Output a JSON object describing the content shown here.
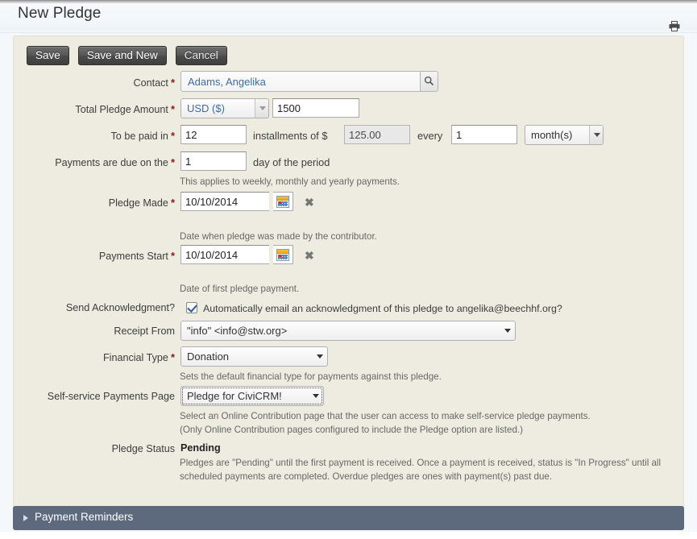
{
  "header": {
    "title": "New Pledge",
    "print_icon": "print-icon"
  },
  "toolbar": {
    "save_label": "Save",
    "save_and_new_label": "Save and New",
    "cancel_label": "Cancel"
  },
  "form": {
    "contact": {
      "label": "Contact",
      "required": "*",
      "value": "Adams, Angelika",
      "search_icon": "search-icon"
    },
    "total_pledge_amount": {
      "label": "Total Pledge Amount",
      "required": "*",
      "currency": "USD ($)",
      "amount": "1500"
    },
    "to_be_paid_in": {
      "label": "To be paid in",
      "required": "*",
      "installments": "12",
      "mid_text": "installments of $",
      "installment_amount": "125.00",
      "every_text": "every",
      "frequency_interval": "1",
      "frequency_unit": "month(s)"
    },
    "payments_due": {
      "label": "Payments are due on the",
      "required": "*",
      "day": "1",
      "suffix_text": "day of the period",
      "help": "This applies to weekly, monthly and yearly payments."
    },
    "pledge_made": {
      "label": "Pledge Made",
      "required": "*",
      "date": "10/10/2014",
      "calendar_icon": "calendar-icon",
      "clear_icon": "✖",
      "help": "Date when pledge was made by the contributor."
    },
    "payments_start": {
      "label": "Payments Start",
      "required": "*",
      "date": "10/10/2014",
      "calendar_icon": "calendar-icon",
      "clear_icon": "✖",
      "help": "Date of first pledge payment."
    },
    "send_acknowledgment": {
      "label": "Send Acknowledgment?",
      "checkbox_label": "Automatically email an acknowledgment of this pledge to angelika@beechhf.org?",
      "checked": true
    },
    "receipt_from": {
      "label": "Receipt From",
      "value": "\"info\" <info@stw.org>"
    },
    "financial_type": {
      "label": "Financial Type",
      "required": "*",
      "value": "Donation",
      "help": "Sets the default financial type for payments against this pledge."
    },
    "self_service_page": {
      "label": "Self-service Payments Page",
      "value": "Pledge for CiviCRM!",
      "help_line1": "Select an Online Contribution page that the user can access to make self-service pledge payments.",
      "help_line2": "(Only Online Contribution pages configured to include the Pledge option are listed.)"
    },
    "pledge_status": {
      "label": "Pledge Status",
      "value": "Pending",
      "help": "Pledges are \"Pending\" until the first payment is received. Once a payment is received, status is \"In Progress\" until all scheduled payments are completed. Overdue pledges are ones with payment(s) past due."
    }
  },
  "accordion": {
    "payment_reminders_label": "Payment Reminders",
    "expand_icon": "chevron-right-icon"
  },
  "colors": {
    "form_background": "#eeece1",
    "button_dark": "#4b4b4b",
    "required_star": "#8b1a1a",
    "accordion_bar": "#5d6a7e",
    "link_blue": "#3b6ea5"
  }
}
